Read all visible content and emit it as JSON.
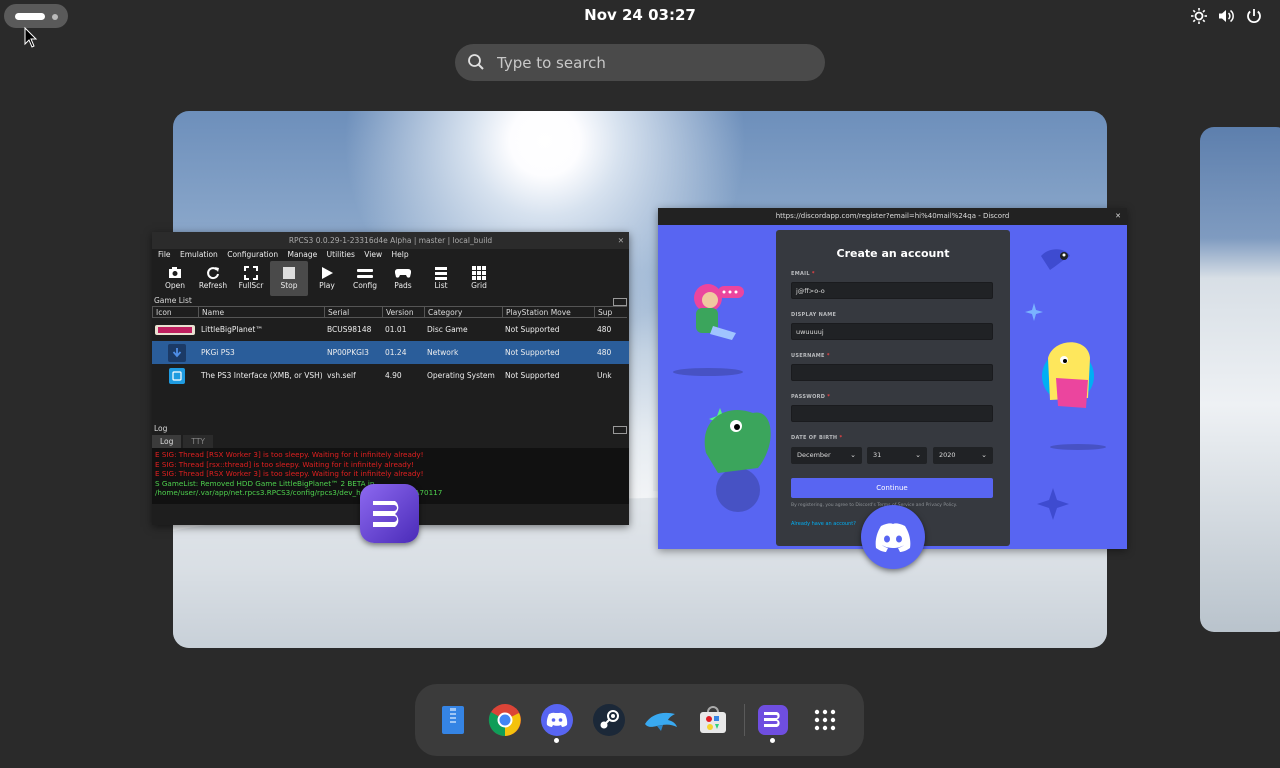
{
  "topbar": {
    "clock": "Nov 24  03:27"
  },
  "search": {
    "placeholder": "Type to search"
  },
  "rpcs3": {
    "title": "RPCS3 0.0.29-1-23316d4e Alpha | master | local_build",
    "menu": [
      "File",
      "Emulation",
      "Configuration",
      "Manage",
      "Utilities",
      "View",
      "Help"
    ],
    "toolbar": [
      "Open",
      "Refresh",
      "FullScr",
      "Stop",
      "Play",
      "Config",
      "Pads",
      "List",
      "Grid"
    ],
    "game_list_title": "Game List",
    "columns": [
      "Icon",
      "Name",
      "Serial",
      "Version",
      "Category",
      "PlayStation Move",
      "Sup"
    ],
    "rows": [
      {
        "name": "LittleBigPlanet™",
        "serial": "BCUS98148",
        "version": "01.01",
        "category": "Disc Game",
        "move": "Not Supported",
        "sup": "480"
      },
      {
        "name": "PKGi PS3",
        "serial": "NP00PKGI3",
        "version": "01.24",
        "category": "Network",
        "move": "Not Supported",
        "sup": "480"
      },
      {
        "name": "The PS3 Interface (XMB, or VSH)",
        "serial": "vsh.self",
        "version": "4.90",
        "category": "Operating System",
        "move": "Not Supported",
        "sup": "Unk"
      }
    ],
    "log_title": "Log",
    "log_tabs": [
      "Log",
      "TTY"
    ],
    "log_lines": [
      "E SIG: Thread [RSX Worker 3] is too sleepy. Waiting for it infinitely already!",
      "E SIG: Thread [rsx::thread] is too sleepy. Waiting for it infinitely already!",
      "E SIG: Thread [RSX Worker 3] is too sleepy. Waiting for it infinitely already!",
      "S GameList: Removed HDD Game LittleBigPlanet™ 2 BETA in /home/user/.var/app/net.rpcs3.RPCS3/config/rpcs3/dev_hdd0/game/NPUA70117"
    ]
  },
  "discord": {
    "url": "https://discordapp.com/register?email=hi%40mail%24qa - Discord",
    "header": "Create an account",
    "email_label": "EMAIL",
    "email_value": "j@ff>o-o",
    "display_label": "DISPLAY NAME",
    "display_value": "uwuuuuj",
    "username_label": "USERNAME",
    "password_label": "PASSWORD",
    "dob_label": "DATE OF BIRTH",
    "month": "December",
    "day": "31",
    "year": "2020",
    "continue": "Continue",
    "terms": "By registering, you agree to Discord's Terms of Service and Privacy Policy.",
    "login_link": "Already have an account?"
  },
  "dock": [
    "files-icon",
    "chrome-icon",
    "discord-icon",
    "steam-icon",
    "dolphin-icon",
    "software-icon",
    "rpcs3-icon",
    "app-grid-icon"
  ],
  "colors": {
    "discord": "#5865f2",
    "rpcs3_select": "#2a5d9a",
    "log_error": "#e02020",
    "log_success": "#4ed14e"
  }
}
